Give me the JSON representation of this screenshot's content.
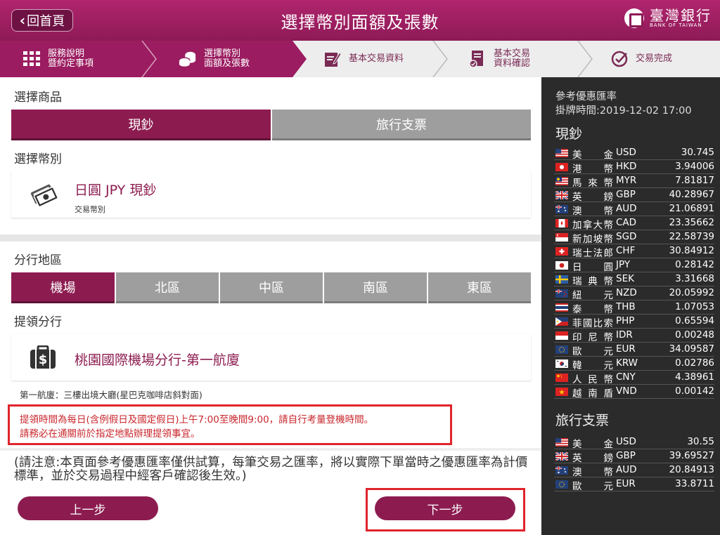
{
  "header": {
    "back_label": "回首頁",
    "title": "選擇幣別面額及張數",
    "logo_zh": "臺灣銀行",
    "logo_en": "BANK OF TAIWAN"
  },
  "steps": [
    {
      "line1": "服務說明",
      "line2": "暨約定事項",
      "icon": "grid-icon"
    },
    {
      "line1": "選擇幣別",
      "line2": "面額及張數",
      "icon": "coins-icon"
    },
    {
      "line1": "基本交易資料",
      "line2": "",
      "icon": "edit-form-icon"
    },
    {
      "line1": "基本交易",
      "line2": "資料確認",
      "icon": "document-check-icon"
    },
    {
      "line1": "交易完成",
      "line2": "",
      "icon": "check-circle-icon"
    }
  ],
  "product": {
    "label": "選擇商品",
    "options": [
      "現鈔",
      "旅行支票"
    ],
    "selected": "現鈔"
  },
  "currency": {
    "label": "選擇幣別",
    "value": "日圓 JPY 現鈔",
    "sub": "交易幣別",
    "icon": "banknote-icon"
  },
  "region": {
    "label": "分行地區",
    "options": [
      "機場",
      "北區",
      "中區",
      "南區",
      "東區"
    ],
    "selected": "機場"
  },
  "branch": {
    "label": "提領分行",
    "value": "桃園國際機場分行-第一航廈",
    "icon": "wallet-dollar-icon",
    "location_note": "第一航廈：三樓出境大廳(星巴克咖啡店斜對面)",
    "warning_line1": "提領時間為每日(含例假日及國定假日)上午7:00至晚間9:00，請自行考量登機時間。",
    "warning_line2": "請務必在通關前於指定地點辦理提領事宜。"
  },
  "disclaimer": "(請注意:本頁面參考優惠匯率僅供試算，每筆交易之匯率，將以實際下單當時之優惠匯率為計價標準，並於交易過程中經客戶確認後生效。)",
  "buttons": {
    "prev": "上一步",
    "next": "下一步"
  },
  "rates": {
    "title": "參考優惠匯率",
    "posted": "掛牌時間:2019-12-02 17:00",
    "cash_heading": "現鈔",
    "cash": [
      {
        "name": "美　金",
        "code": "USD",
        "rate": "30.745",
        "flag": "us-flag-icon"
      },
      {
        "name": "港　幣",
        "code": "HKD",
        "rate": "3.94006",
        "flag": "hk-flag-icon"
      },
      {
        "name": "馬來幣",
        "code": "MYR",
        "rate": "7.81817",
        "flag": "my-flag-icon"
      },
      {
        "name": "英　鎊",
        "code": "GBP",
        "rate": "40.28967",
        "flag": "gb-flag-icon"
      },
      {
        "name": "澳　幣",
        "code": "AUD",
        "rate": "21.06891",
        "flag": "au-flag-icon"
      },
      {
        "name": "加拿大幣",
        "code": "CAD",
        "rate": "23.35662",
        "flag": "ca-flag-icon"
      },
      {
        "name": "新加坡幣",
        "code": "SGD",
        "rate": "22.58739",
        "flag": "sg-flag-icon"
      },
      {
        "name": "瑞士法郎",
        "code": "CHF",
        "rate": "30.84912",
        "flag": "ch-flag-icon"
      },
      {
        "name": "日　圓",
        "code": "JPY",
        "rate": "0.28142",
        "flag": "jp-flag-icon"
      },
      {
        "name": "瑞典幣",
        "code": "SEK",
        "rate": "3.31668",
        "flag": "se-flag-icon"
      },
      {
        "name": "紐　元",
        "code": "NZD",
        "rate": "20.05992",
        "flag": "nz-flag-icon"
      },
      {
        "name": "泰　幣",
        "code": "THB",
        "rate": "1.07053",
        "flag": "th-flag-icon"
      },
      {
        "name": "菲國比索",
        "code": "PHP",
        "rate": "0.65594",
        "flag": "ph-flag-icon"
      },
      {
        "name": "印尼幣",
        "code": "IDR",
        "rate": "0.00248",
        "flag": "id-flag-icon"
      },
      {
        "name": "歐　元",
        "code": "EUR",
        "rate": "34.09587",
        "flag": "eu-flag-icon"
      },
      {
        "name": "韓　元",
        "code": "KRW",
        "rate": "0.02786",
        "flag": "kr-flag-icon"
      },
      {
        "name": "人民幣",
        "code": "CNY",
        "rate": "4.38961",
        "flag": "cn-flag-icon"
      },
      {
        "name": "越南盾",
        "code": "VND",
        "rate": "0.00142",
        "flag": "vn-flag-icon"
      }
    ],
    "tc_heading": "旅行支票",
    "tc": [
      {
        "name": "美　金",
        "code": "USD",
        "rate": "30.55",
        "flag": "us-flag-icon"
      },
      {
        "name": "英　鎊",
        "code": "GBP",
        "rate": "39.69527",
        "flag": "gb-flag-icon"
      },
      {
        "name": "澳　幣",
        "code": "AUD",
        "rate": "20.84913",
        "flag": "au-flag-icon"
      },
      {
        "name": "歐　元",
        "code": "EUR",
        "rate": "33.8711",
        "flag": "eu-flag-icon"
      }
    ]
  },
  "colors": {
    "brand": "#8c1c50",
    "header": "#a3205f",
    "warning": "#e0242c",
    "sidebar": "#2b2b2b"
  }
}
